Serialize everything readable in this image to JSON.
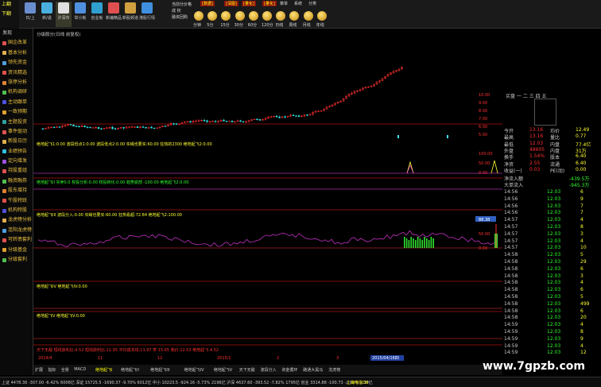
{
  "toolbar": {
    "left_items": [
      "上翻",
      "下翻"
    ],
    "buttons": [
      {
        "label": "日/上"
      },
      {
        "label": "新/退"
      },
      {
        "label": "沪深市"
      },
      {
        "label": "举小板"
      },
      {
        "label": "创业板"
      },
      {
        "label": "新编精品"
      },
      {
        "label": "新股频道"
      },
      {
        "label": "港股行情"
      }
    ],
    "menu": [
      "[数据]",
      "[深图]",
      "[量化]",
      "[量化]",
      "菜单",
      "系统",
      "分类"
    ],
    "side_menu": [
      "当前分价格",
      "成 权",
      "融资回购"
    ],
    "periods": [
      "分钟",
      "5分",
      "15分",
      "30分",
      "60分",
      "120分",
      "日线",
      "周线",
      "月线",
      "年线"
    ]
  },
  "sidebar": {
    "title": "发现",
    "items": [
      {
        "label": "国企改革",
        "color": "#e05050"
      },
      {
        "label": "基本分析",
        "color": "#e0b050"
      },
      {
        "label": "领先资金",
        "color": "#50a0e0"
      },
      {
        "label": "资讯精选",
        "color": "#e05050"
      },
      {
        "label": "涨停分析",
        "color": "#e08030"
      },
      {
        "label": "机构调研",
        "color": "#50c050"
      },
      {
        "label": "主动跟单",
        "color": "#5050e0"
      },
      {
        "label": "一致预期",
        "color": "#e0a030"
      },
      {
        "label": "主题投资",
        "color": "#30a0a0"
      },
      {
        "label": "事件驱动",
        "color": "#e05050"
      },
      {
        "label": "新股日历",
        "color": "#e0b050"
      },
      {
        "label": "业绩预告",
        "color": "#30c0e0"
      },
      {
        "label": "定向增发",
        "color": "#a050e0"
      },
      {
        "label": "持股重组",
        "color": "#e05050"
      },
      {
        "label": "融资融券",
        "color": "#50c050"
      },
      {
        "label": "股东增持",
        "color": "#e08030"
      },
      {
        "label": "牛股特跃",
        "color": "#e05050"
      },
      {
        "label": "机构特股",
        "color": "#5050e0"
      },
      {
        "label": "龙虎榜分析",
        "color": "#e0b050"
      },
      {
        "label": "连阳龙虎榜",
        "color": "#50a0e0"
      },
      {
        "label": "可转债套利",
        "color": "#e05050"
      },
      {
        "label": "分级基金",
        "color": "#e0a030"
      },
      {
        "label": "分级套利",
        "color": "#50c050"
      }
    ]
  },
  "chart": {
    "title": "分级股分(日线 前复权)",
    "watermark": "www.7gpzb.com",
    "date_label": "2015/04/16四",
    "axis_dates": [
      "2014/4",
      "11",
      "12",
      "2015/1",
      "2",
      "3",
      "4"
    ],
    "panes": [
      {
        "name": "绝地起飞1",
        "text": "绝地起飞1:0.00  波段低点1:0.00  波段低点2:0.00  买绳也要买:60.00  狂热的2300  绝地起飞2:0.00"
      },
      {
        "name": "绝地起飞II",
        "text": "绝地起飞II  买卖0.0  权投分析:0.00  权投转化:0.00  趋势底部 -100.00  绝地起飞2:0.00"
      },
      {
        "name": "绝地起飞III",
        "text": "绝地起飞III  波段分入:0.00  买绳也要买:60.00  狂热看超:72.84  绝地起飞2:100.00"
      },
      {
        "name": "绝地起飞IV",
        "text": "绝地起飞IV  绝地起飞IV:0.00"
      },
      {
        "name": "绝地起飞V",
        "text": "绝地起飞V  绝地起飞V:0.00"
      },
      {
        "name": "天下无敌",
        "text": "天下无敌  短线获利比:4.52  短线获利比:11.95  平均成本线:11.97  乖 15.65  我价:12.03  绝地起飞:4.52"
      }
    ],
    "y_labels_top": [
      "10.00",
      "9.00",
      "8.00",
      "7.00",
      "6.00",
      "5.00"
    ],
    "y_labels_pane1": [
      "100.00",
      "50.00",
      "0.00"
    ],
    "y_labels_pane3": [
      "88.38",
      "50.00",
      "0.00"
    ],
    "y_labels_bottom": [
      "15.00",
      "12.03",
      "10.00"
    ]
  },
  "rightpanel": {
    "quote_rows": [
      {
        "label": "今开",
        "value": "13.16",
        "label2": "均价",
        "value2": "12.49"
      },
      {
        "label": "最高",
        "value": "13.16",
        "label2": "量比",
        "value2": "0.77"
      },
      {
        "label": "最低",
        "value": "12.03",
        "label2": "内盘",
        "value2": "77.4亿"
      },
      {
        "label": "外盘",
        "value": "48605",
        "label2": "内盘",
        "value2": "31万"
      },
      {
        "label": "换手",
        "value": "1.54%",
        "label2": "股本",
        "value2": "6.40"
      },
      {
        "label": "净资",
        "value": "2.55",
        "label2": "流通",
        "value2": "6.40"
      },
      {
        "label": "收益(一)",
        "value": "0.03",
        "label2": "PE(动)",
        "value2": "0.00"
      }
    ],
    "flow_rows": [
      {
        "label": "净流入额",
        "value": "-439.5万"
      },
      {
        "label": "大单流入",
        "value": "-945.3万"
      }
    ],
    "ticks": [
      {
        "time": "14:56",
        "price": "12.03",
        "vol": "6"
      },
      {
        "time": "14:56",
        "price": "12.03",
        "vol": "9"
      },
      {
        "time": "14:56",
        "price": "12.03",
        "vol": "7"
      },
      {
        "time": "14:56",
        "price": "12.03",
        "vol": "7"
      },
      {
        "time": "14:57",
        "price": "12.03",
        "vol": "4"
      },
      {
        "time": "14:57",
        "price": "12.03",
        "vol": "8"
      },
      {
        "time": "14:57",
        "price": "12.03",
        "vol": "3"
      },
      {
        "time": "14:57",
        "price": "12.03",
        "vol": "4"
      },
      {
        "time": "14:57",
        "price": "12.03",
        "vol": "10"
      },
      {
        "time": "14:58",
        "price": "12.03",
        "vol": "5"
      },
      {
        "time": "14:58",
        "price": "12.03",
        "vol": "29"
      },
      {
        "time": "14:58",
        "price": "12.03",
        "vol": "6"
      },
      {
        "time": "14:58",
        "price": "12.03",
        "vol": "3"
      },
      {
        "time": "14:58",
        "price": "12.03",
        "vol": "4"
      },
      {
        "time": "14:58",
        "price": "12.03",
        "vol": "6"
      },
      {
        "time": "14:58",
        "price": "12.03",
        "vol": "5"
      },
      {
        "time": "14:58",
        "price": "12.03",
        "vol": "499"
      },
      {
        "time": "14:58",
        "price": "12.03",
        "vol": "6"
      },
      {
        "time": "14:58",
        "price": "12.03",
        "vol": "20"
      },
      {
        "time": "14:59",
        "price": "12.03",
        "vol": "4"
      },
      {
        "time": "14:59",
        "price": "12.03",
        "vol": "8"
      },
      {
        "time": "14:59",
        "price": "12.03",
        "vol": "9"
      },
      {
        "time": "14:59",
        "price": "12.03",
        "vol": "4"
      },
      {
        "time": "14:59",
        "price": "12.03",
        "vol": "12"
      }
    ],
    "header": "买盘  一 二 三 四 五"
  },
  "tabbar": {
    "tabs": [
      "扩展",
      "指标",
      "全景",
      "MACD",
      "绝地起飞I",
      "绝地起飞II",
      "绝地起飞III",
      "绝地起飞IV",
      "绝地起飞V",
      "天下无敌",
      "波段分入",
      "资金循环",
      "路通大黑马",
      "龙虎榜"
    ]
  },
  "statusbar": {
    "text": "上证 4478.36  -307.00  -6.42%  6006亿  深证 15725.5  -1690.37  -9.70%  6012亿  中小 10223.5  -924.16  -5.73%  2196亿  沪深 4637.60  -393.52  -7.82%  1795亿  创业 3314.88  -100.73  -2.92%  1.39亿",
    "right_text": "上海电信D8"
  }
}
